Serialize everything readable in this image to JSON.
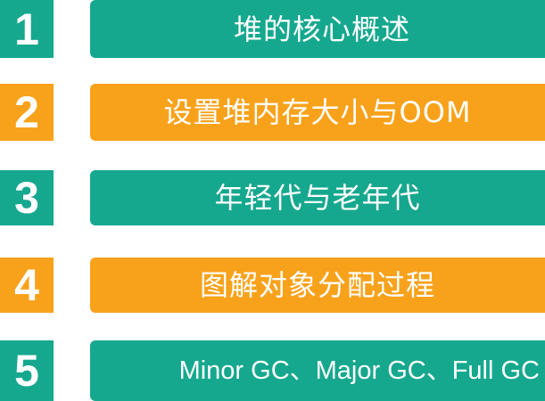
{
  "colors": {
    "green": "#16a88e",
    "orange": "#f8a21b",
    "text": "#ffffff"
  },
  "items": [
    {
      "number": "1",
      "label": "堆的核心概述",
      "color": "green"
    },
    {
      "number": "2",
      "label": "设置堆内存大小与OOM",
      "color": "orange"
    },
    {
      "number": "3",
      "label": "年轻代与老年代",
      "color": "green"
    },
    {
      "number": "4",
      "label": "图解对象分配过程",
      "color": "orange"
    },
    {
      "number": "5",
      "label": "Minor GC、Major GC、Full GC",
      "color": "green"
    }
  ]
}
